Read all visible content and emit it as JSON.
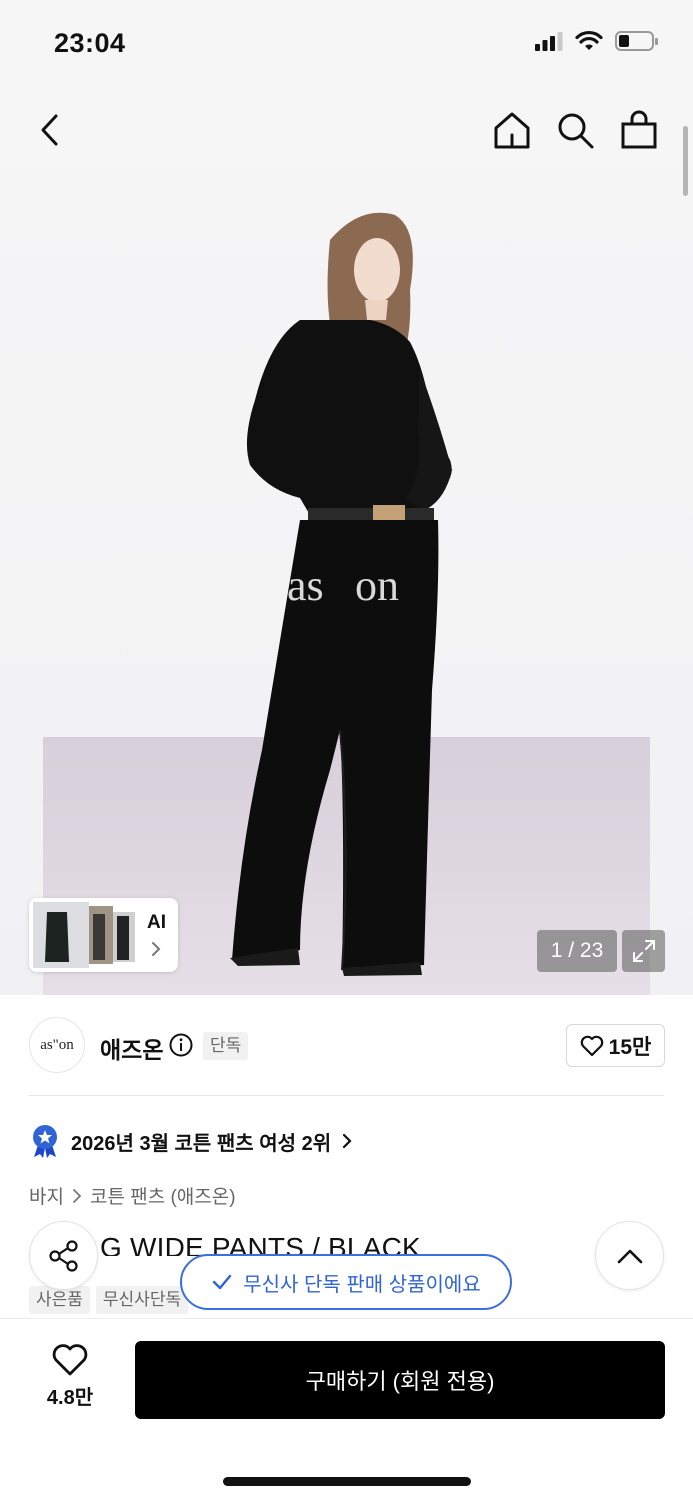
{
  "status_bar": {
    "time": "23:04"
  },
  "nav": {
    "back": "back",
    "home": "home",
    "search": "search",
    "cart": "cart"
  },
  "hero": {
    "counter": "1 / 23",
    "ai_label": "AI",
    "pants_print_left": "as",
    "pants_print_right": "on"
  },
  "brand": {
    "logo_text": "as\"on",
    "name": "애즈온",
    "badge": "단독",
    "likes": "15만"
  },
  "ranking": {
    "text": "2026년 3월 코튼 팬츠 여성 2위"
  },
  "breadcrumb": {
    "category": "바지",
    "subcategory": "코튼 팬츠 (애즈온)"
  },
  "product": {
    "title": "G WIDE PANTS / BLACK",
    "tags": [
      "사은품",
      "무신사단독"
    ]
  },
  "toast": {
    "text": "무신사 단독 판매 상품이에요"
  },
  "bottom": {
    "wish_count": "4.8만",
    "buy_label": "구매하기 (회원 전용)"
  },
  "colors": {
    "accent_blue": "#2f63d6",
    "black": "#000000",
    "badge_bg": "#f1f1f1"
  }
}
